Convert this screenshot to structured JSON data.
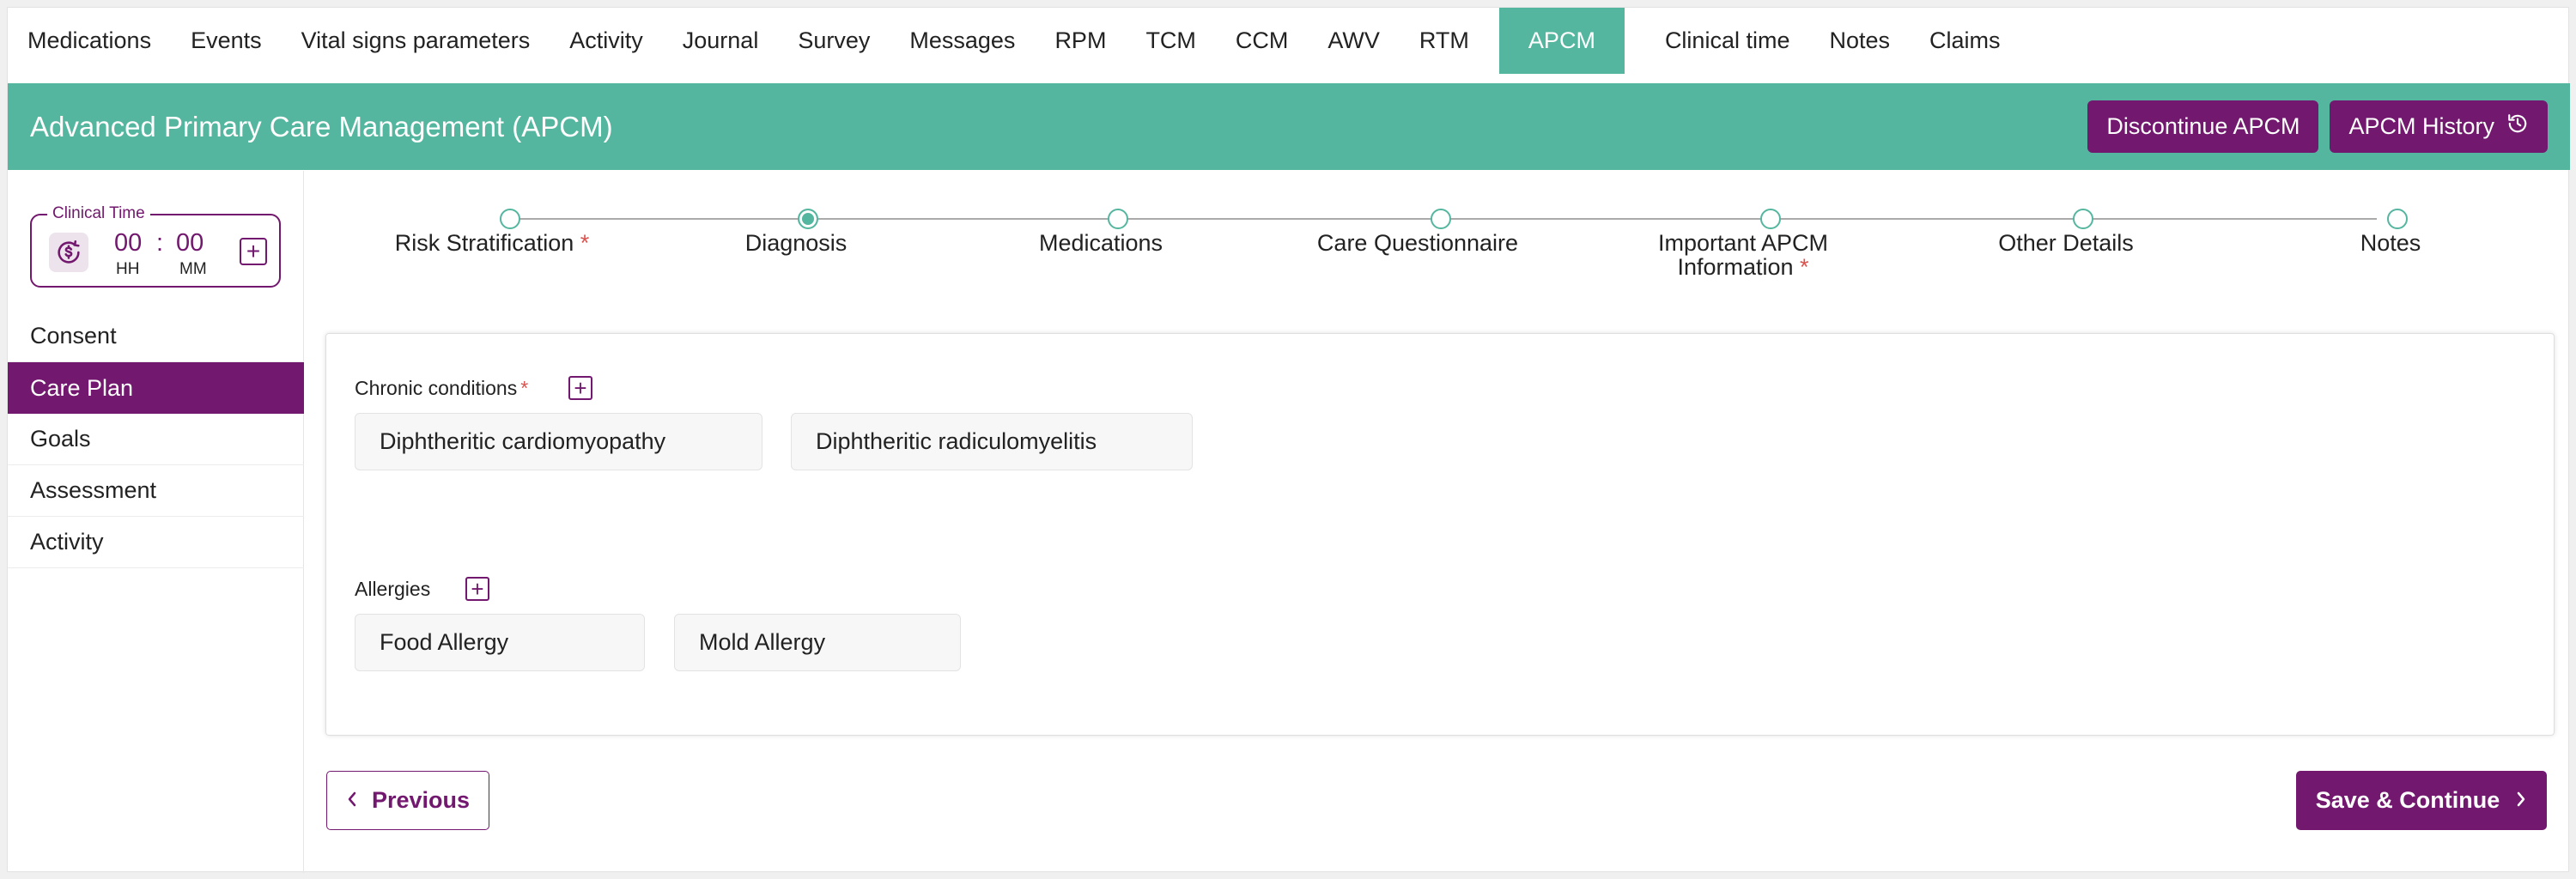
{
  "top_tabs": [
    "Medications",
    "Events",
    "Vital signs parameters",
    "Activity",
    "Journal",
    "Survey",
    "Messages",
    "RPM",
    "TCM",
    "CCM",
    "AWV",
    "RTM",
    "APCM",
    "Clinical time",
    "Notes",
    "Claims"
  ],
  "active_tab": "APCM",
  "header": {
    "title": "Advanced Primary Care Management (APCM)",
    "discontinue_label": "Discontinue APCM",
    "history_label": "APCM History"
  },
  "clinical_time": {
    "legend": "Clinical Time",
    "hours": "00",
    "separator": ":",
    "minutes": "00",
    "hours_unit": "HH",
    "minutes_unit": "MM"
  },
  "sidebar": {
    "items": [
      "Consent",
      "Care Plan",
      "Goals",
      "Assessment",
      "Activity"
    ],
    "active": "Care Plan"
  },
  "stepper": {
    "steps": [
      {
        "label": "Risk Stratification",
        "required": true,
        "state": "pending"
      },
      {
        "label": "Diagnosis",
        "required": false,
        "state": "current"
      },
      {
        "label": "Medications",
        "required": false,
        "state": "pending"
      },
      {
        "label": "Care Questionnaire",
        "required": false,
        "state": "pending"
      },
      {
        "label_line1": "Important APCM",
        "label_line2": "Information",
        "required": true,
        "state": "pending"
      },
      {
        "label": "Other Details",
        "required": false,
        "state": "pending"
      },
      {
        "label": "Notes",
        "required": false,
        "state": "pending"
      }
    ],
    "required_mark": "*"
  },
  "chronic": {
    "label": "Chronic conditions",
    "required_mark": "*",
    "items": [
      "Diphtheritic cardiomyopathy",
      "Diphtheritic radiculomyelitis"
    ]
  },
  "allergies": {
    "label": "Allergies",
    "items": [
      "Food Allergy",
      "Mold Allergy"
    ]
  },
  "footer": {
    "previous_label": "Previous",
    "save_label": "Save & Continue"
  },
  "colors": {
    "teal": "#55b6a0",
    "purple": "#72186e",
    "required": "#d9534f"
  },
  "icons": {
    "history": "history-icon",
    "clock": "clock-dollar-icon",
    "add": "plus-square-icon",
    "prev": "chevron-left-icon",
    "next": "chevron-right-icon"
  }
}
